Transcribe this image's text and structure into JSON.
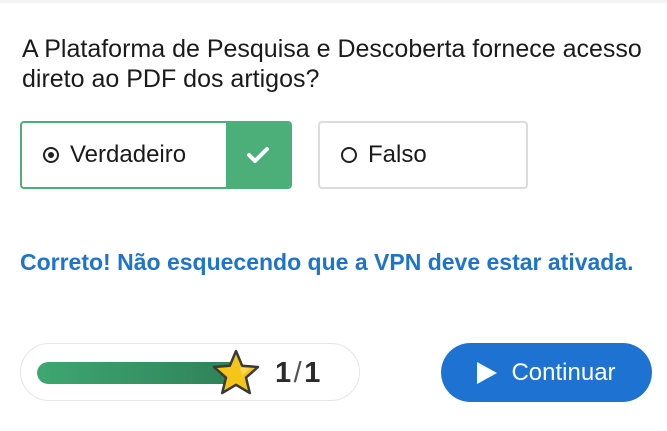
{
  "question": {
    "text": "A Plataforma de Pesquisa e Descoberta fornece acesso direto ao PDF dos artigos?"
  },
  "options": [
    {
      "label": "Verdadeiro",
      "selected": true,
      "state": "correct",
      "check_icon": "check-icon"
    },
    {
      "label": "Falso",
      "selected": false,
      "state": "neutral"
    }
  ],
  "feedback": {
    "text": "Correto! Não esquecendo que a VPN deve estar ativada."
  },
  "progress": {
    "fraction": 1.0,
    "current": "1",
    "separator": "/",
    "total": "1",
    "star_icon": "star-icon"
  },
  "continue_button": {
    "label": "Continuar",
    "icon": "play-icon"
  },
  "colors": {
    "correct_green": "#4caf7a",
    "feedback_blue": "#1f74c9",
    "button_blue": "#1e73d2",
    "star_yellow": "#f5c518"
  }
}
